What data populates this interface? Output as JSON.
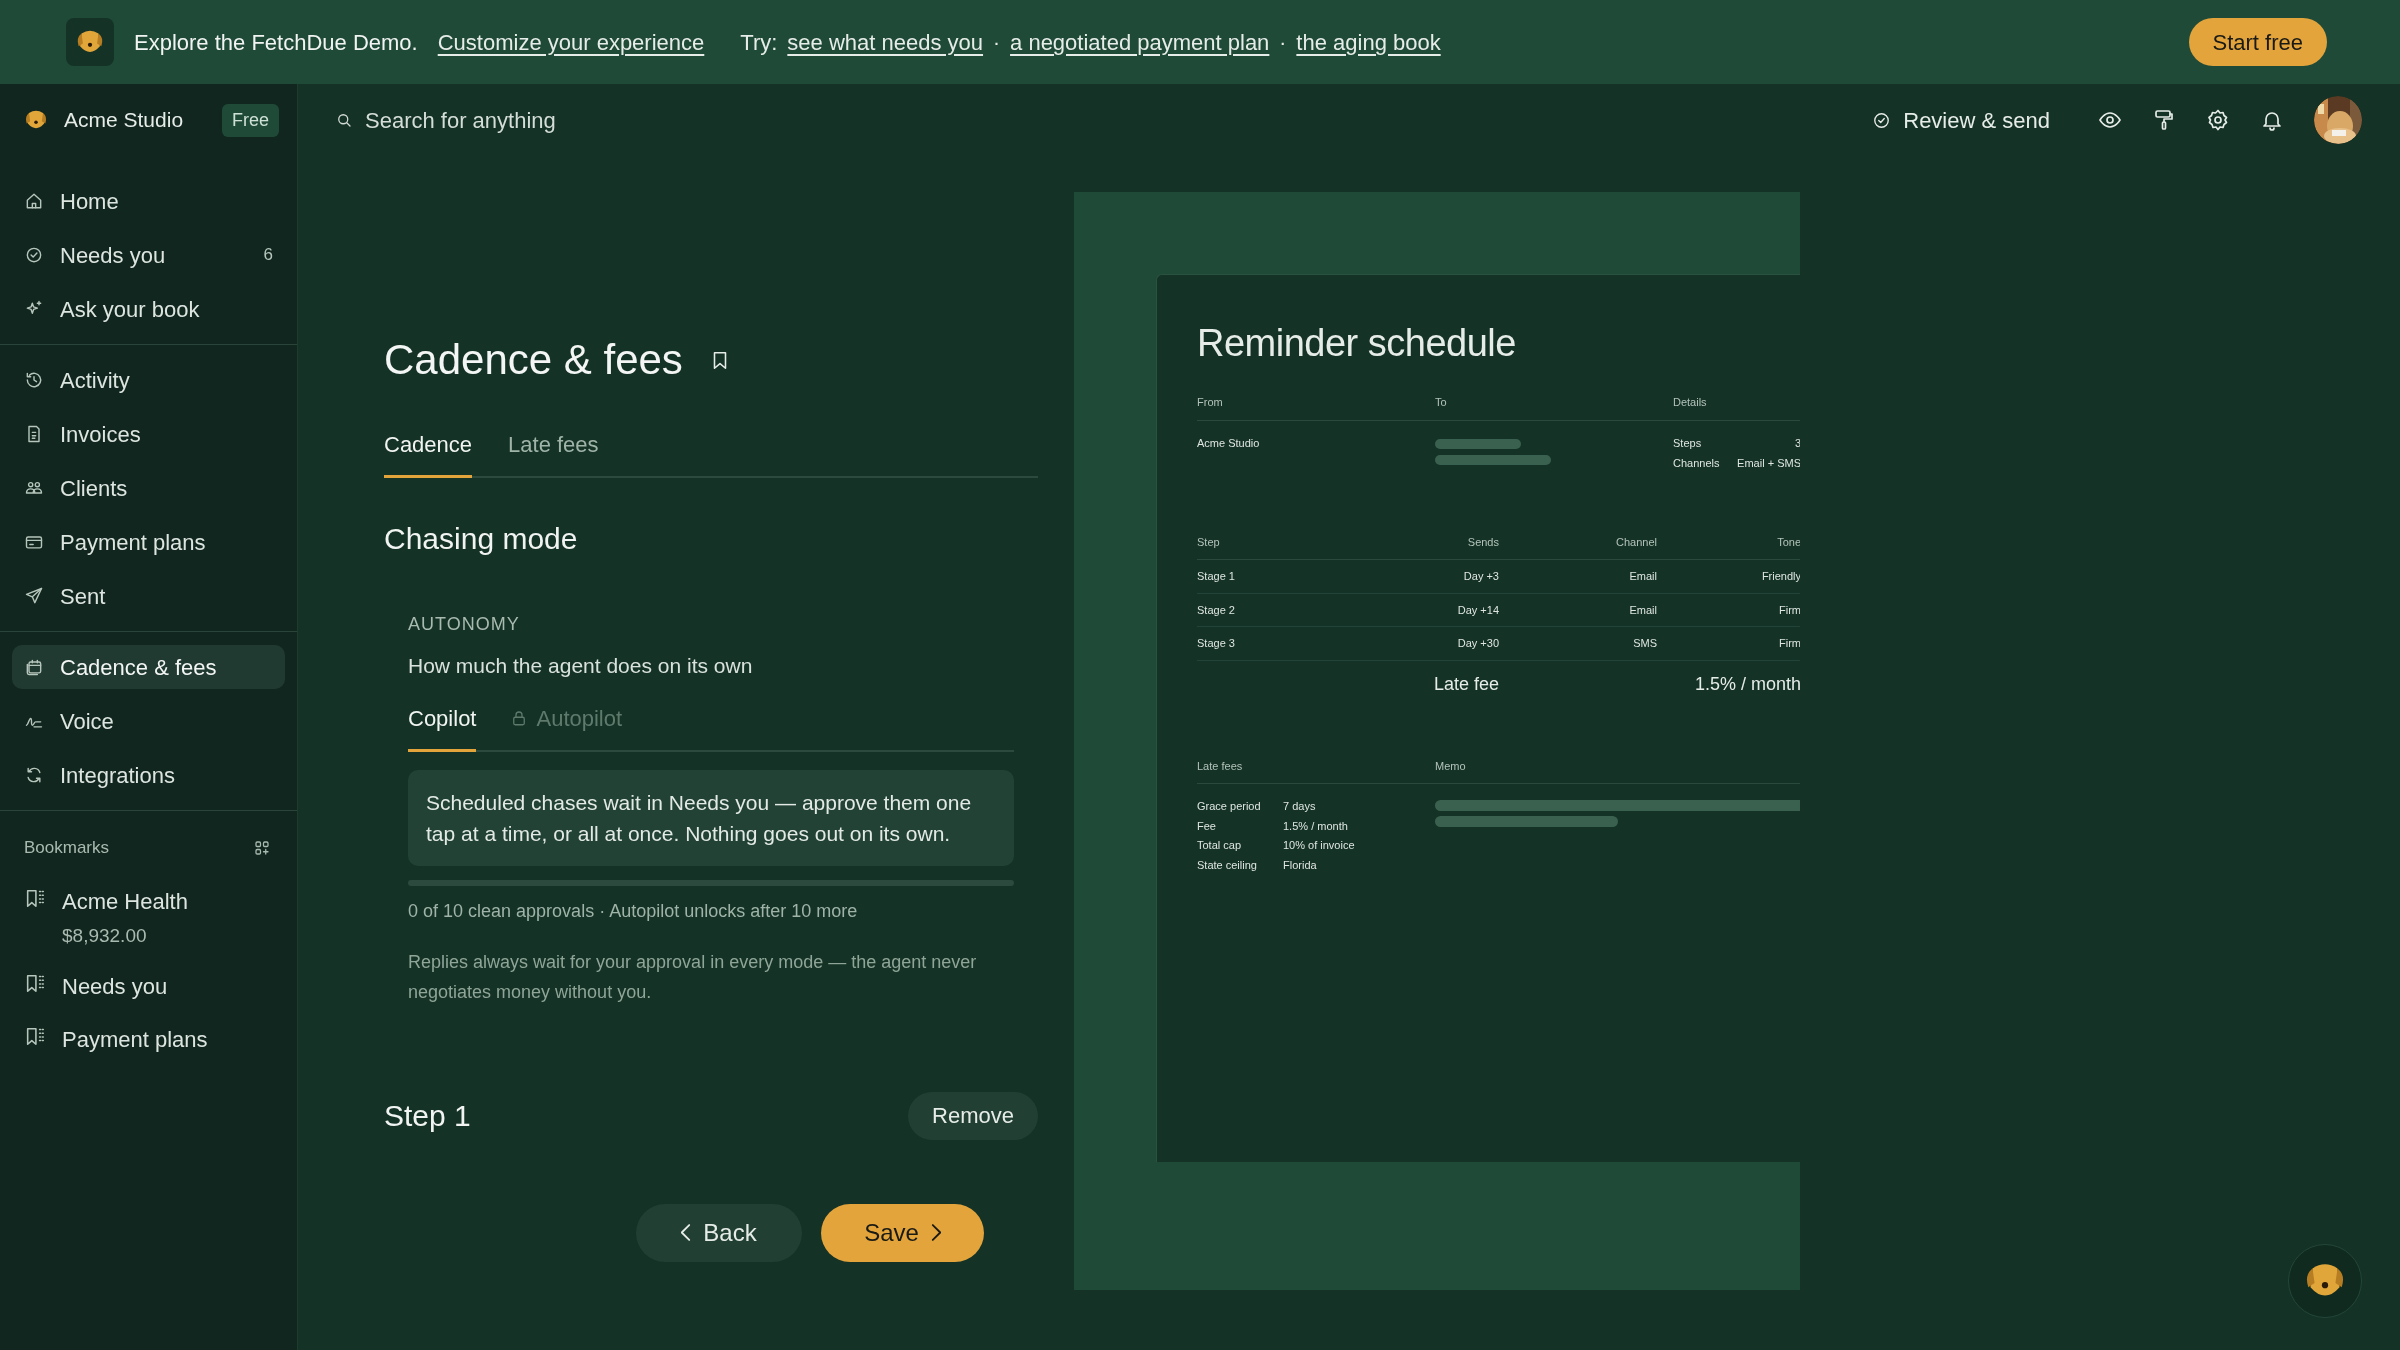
{
  "banner": {
    "message": "Explore the FetchDue Demo.",
    "customize_link": "Customize your experience",
    "try_label": "Try:",
    "try_links": [
      "see what needs you",
      "a negotiated payment plan",
      "the aging book"
    ],
    "separator": "·",
    "start_button": "Start free"
  },
  "header": {
    "workspace": "Acme Studio",
    "plan_badge": "Free",
    "search": {
      "placeholder": "Search for anything"
    },
    "review_button": "Review & send"
  },
  "sidebar": {
    "sections": [
      {
        "items": [
          {
            "label": "Home",
            "selected": false
          },
          {
            "label": "Needs you",
            "count": "6",
            "selected": false
          },
          {
            "label": "Ask your book",
            "selected": false
          }
        ]
      },
      {
        "items": [
          {
            "label": "Activity",
            "selected": false
          },
          {
            "label": "Invoices",
            "selected": false
          },
          {
            "label": "Clients",
            "selected": false
          },
          {
            "label": "Payment plans",
            "selected": false
          },
          {
            "label": "Sent",
            "selected": false
          }
        ]
      },
      {
        "items": [
          {
            "label": "Cadence & fees",
            "selected": true
          },
          {
            "label": "Voice",
            "selected": false
          },
          {
            "label": "Integrations",
            "selected": false
          }
        ]
      }
    ],
    "bookmarks": {
      "title": "Bookmarks",
      "items": [
        {
          "label": "Acme Health",
          "sublabel": "$8,932.00"
        },
        {
          "label": "Needs you"
        },
        {
          "label": "Payment plans"
        }
      ]
    }
  },
  "page": {
    "title": "Cadence & fees",
    "tabs": [
      {
        "label": "Cadence",
        "selected": true
      },
      {
        "label": "Late fees",
        "selected": false
      }
    ],
    "section_title": "Chasing mode",
    "autonomy": {
      "label": "AUTONOMY",
      "description": "How much the agent does on its own",
      "modes": [
        {
          "label": "Copilot",
          "selected": true,
          "locked": false
        },
        {
          "label": "Autopilot",
          "selected": false,
          "locked": true
        }
      ],
      "note": "Scheduled chases wait in Needs you — approve them one tap at a time, or all at once. Nothing goes out on its own.",
      "progress": {
        "level": 0,
        "caption": "0 of 10 clean approvals · Autopilot unlocks after 10 more"
      },
      "footnote": "Replies always wait for your approval in every mode — the agent never negotiates money without you."
    },
    "step": {
      "title": "Step 1",
      "remove_button": "Remove"
    },
    "back_button": "Back",
    "save_button": "Save"
  },
  "preview": {
    "title": "Reminder schedule",
    "party_headers": [
      "From",
      "To",
      "Details"
    ],
    "from": "Acme Studio",
    "details": [
      {
        "label": "Steps",
        "value": "3"
      },
      {
        "label": "Channels",
        "value": "Email + SMS"
      }
    ],
    "steps_columns": [
      "Step",
      "Sends",
      "Channel",
      "Tone"
    ],
    "steps_rows": [
      [
        "Stage 1",
        "Day +3",
        "Email",
        "Friendly"
      ],
      [
        "Stage 2",
        "Day +14",
        "Email",
        "Firm"
      ],
      [
        "Stage 3",
        "Day +30",
        "SMS",
        "Firm"
      ]
    ],
    "late_fee": {
      "label": "Late fee",
      "value": "1.5% / month"
    },
    "fees_headers": [
      "Late fees",
      "Memo"
    ],
    "fees_rows": [
      {
        "label": "Grace period",
        "value": "7 days"
      },
      {
        "label": "Fee",
        "value": "1.5% / month"
      },
      {
        "label": "Total cap",
        "value": "10% of invoice"
      },
      {
        "label": "State ceiling",
        "value": "Florida"
      }
    ]
  }
}
